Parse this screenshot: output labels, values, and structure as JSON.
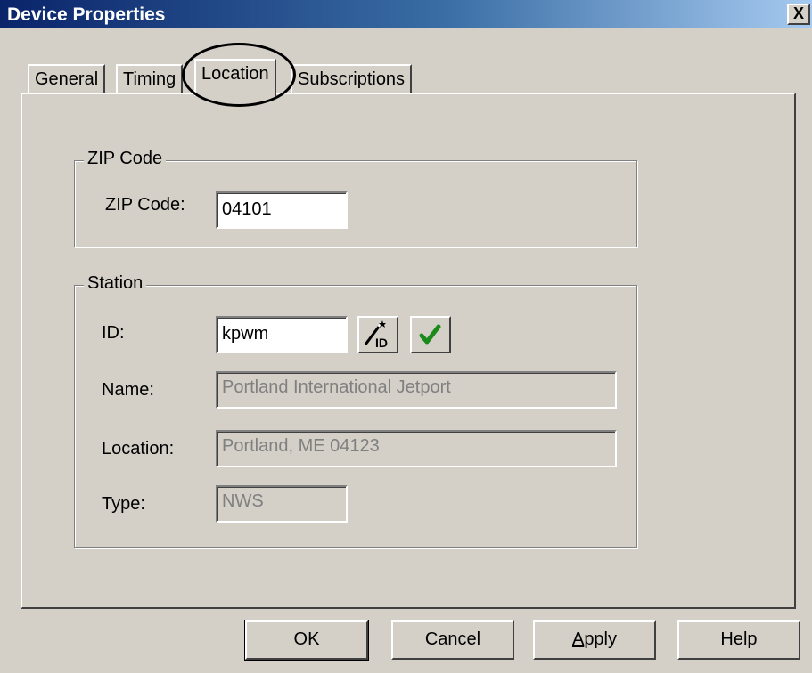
{
  "window": {
    "title": "Device Properties",
    "close_label": "X"
  },
  "tabs": [
    {
      "label": "General"
    },
    {
      "label": "Timing"
    },
    {
      "label": "Location"
    },
    {
      "label": "Subscriptions"
    }
  ],
  "zip_group": {
    "legend": "ZIP Code",
    "zip_label": "ZIP Code:",
    "zip_value": "04101"
  },
  "station_group": {
    "legend": "Station",
    "id_label": "ID:",
    "id_value": "kpwm",
    "id_wizard_icon": "magic-wand-id-icon",
    "verify_icon": "green-checkmark-icon",
    "name_label": "Name:",
    "name_value": "Portland International Jetport",
    "location_label": "Location:",
    "location_value": "Portland, ME 04123",
    "type_label": "Type:",
    "type_value": "NWS"
  },
  "buttons": {
    "ok": "OK",
    "cancel": "Cancel",
    "apply_first": "A",
    "apply_rest": "pply",
    "help": "Help"
  },
  "colors": {
    "titlebar_start": "#0a246a",
    "titlebar_end": "#a6caf0",
    "face": "#d4d0c8",
    "check": "#1a8a1a"
  }
}
